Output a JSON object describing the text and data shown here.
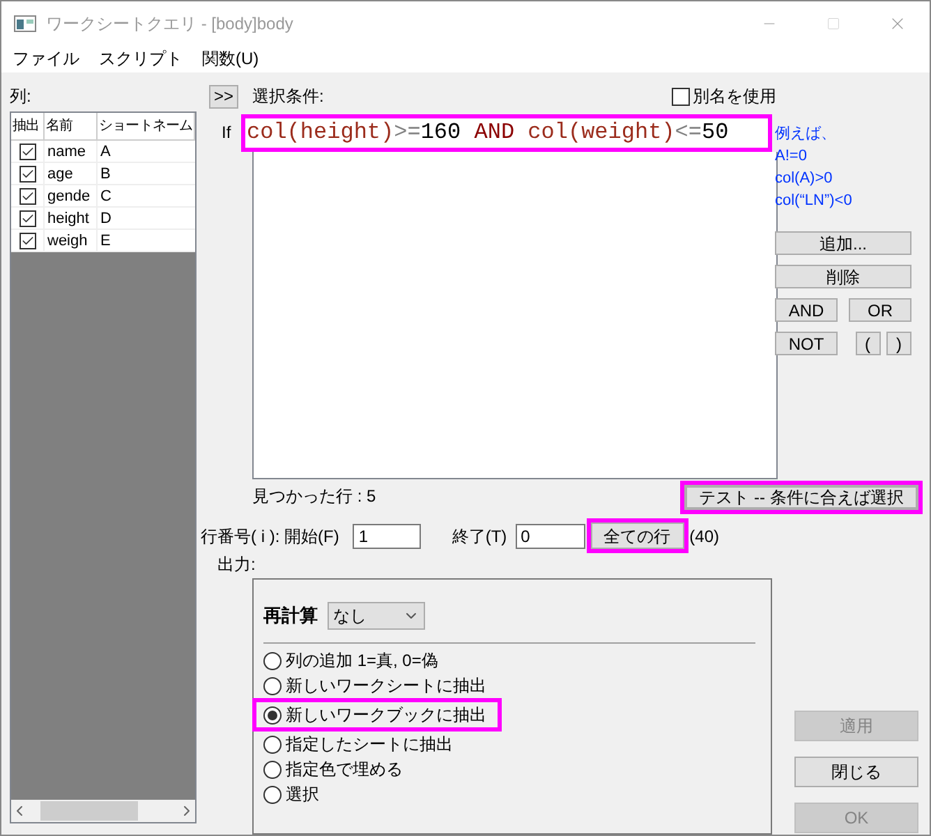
{
  "window": {
    "title": "ワークシートクエリ - [body]body",
    "maximize_disabled": true
  },
  "menu": [
    "ファイル",
    "スクリプト",
    "関数(U)"
  ],
  "columns_panel": {
    "label": "列:",
    "headers": [
      "抽出",
      "名前",
      "ショートネーム"
    ],
    "rows": [
      {
        "checked": true,
        "name": "name",
        "short": "A"
      },
      {
        "checked": true,
        "name": "age",
        "short": "B"
      },
      {
        "checked": true,
        "name": "gende",
        "short": "C"
      },
      {
        "checked": true,
        "name": "height",
        "short": "D"
      },
      {
        "checked": true,
        "name": "weigh",
        "short": "E"
      }
    ]
  },
  "expand_button": ">>",
  "condition_label": "選択条件:",
  "use_alias": {
    "label": "別名を使用",
    "checked": false
  },
  "if_label": "If",
  "condition": {
    "highlighted": true,
    "tokens": [
      {
        "text": "col(height)",
        "kind": "function"
      },
      {
        "text": ">=",
        "kind": "operator"
      },
      {
        "text": "160",
        "kind": "number"
      },
      {
        "text": " AND ",
        "kind": "keyword"
      },
      {
        "text": "col(weight)",
        "kind": "function"
      },
      {
        "text": "<=",
        "kind": "operator"
      },
      {
        "text": "50",
        "kind": "number"
      }
    ]
  },
  "hints": [
    "例えば、",
    "A!=0",
    "col(A)>0",
    "col(“LN”)<0"
  ],
  "side_buttons": [
    {
      "label": "追加...",
      "kind": "wide"
    },
    {
      "label": "削除",
      "kind": "wide"
    },
    {
      "label": "AND",
      "kind": "half"
    },
    {
      "label": "OR",
      "kind": "half"
    },
    {
      "label": "NOT",
      "kind": "half"
    },
    {
      "label": "(",
      "kind": "small"
    },
    {
      "label": ")",
      "kind": "small"
    }
  ],
  "found_rows": "見つかった行 : 5",
  "test_button": {
    "label": "テスト -- 条件に合えば選択",
    "highlighted": true,
    "focused": true
  },
  "row_range": {
    "label": "行番号( i ): 開始(F)",
    "start": "1",
    "end_label": "終了(T)",
    "end": "0",
    "all_button": {
      "label": "全ての行",
      "highlighted": true
    },
    "count": "(40)"
  },
  "output": {
    "label": "出力:",
    "recalc_label": "再計算",
    "recalc_value": "なし",
    "options": [
      {
        "label": "列の追加 1=真, 0=偽",
        "selected": false,
        "highlighted": false
      },
      {
        "label": "新しいワークシートに抽出",
        "selected": false,
        "highlighted": false
      },
      {
        "label": "新しいワークブックに抽出",
        "selected": true,
        "highlighted": true
      },
      {
        "label": "指定したシートに抽出",
        "selected": false,
        "highlighted": false
      },
      {
        "label": "指定色で埋める",
        "selected": false,
        "highlighted": false
      },
      {
        "label": "選択",
        "selected": false,
        "highlighted": false
      }
    ]
  },
  "dialog_buttons": [
    {
      "label": "適用",
      "disabled": true
    },
    {
      "label": "閉じる",
      "disabled": false
    },
    {
      "label": "OK",
      "disabled": true
    }
  ]
}
